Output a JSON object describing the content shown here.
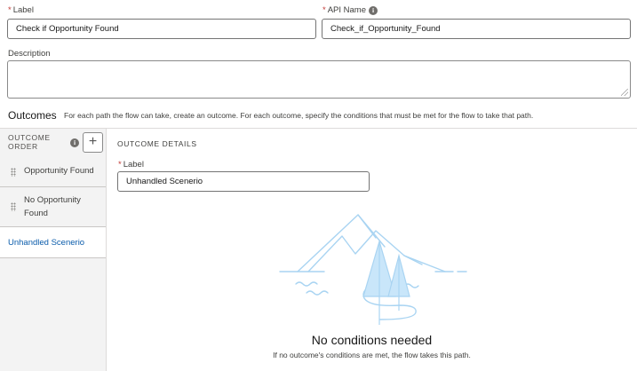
{
  "form": {
    "label": {
      "label": "Label",
      "value": "Check if Opportunity Found"
    },
    "api_name": {
      "label": "API Name",
      "value": "Check_if_Opportunity_Found"
    },
    "description": {
      "label": "Description",
      "value": ""
    }
  },
  "outcomes": {
    "title": "Outcomes",
    "help": "For each path the flow can take, create an outcome. For each outcome, specify the conditions that must be met for the flow to take that path.",
    "order_header_line1": "OUTCOME",
    "order_header_line2": "ORDER",
    "add_button": "+",
    "items": [
      {
        "line1": "Opportunity Found",
        "line2": ""
      },
      {
        "line1": "No Opportunity",
        "line2": "Found"
      },
      {
        "line1": "Unhandled Scenerio",
        "line2": ""
      }
    ]
  },
  "details": {
    "header": "OUTCOME DETAILS",
    "label": {
      "label": "Label",
      "value": "Unhandled Scenerio"
    },
    "empty_title": "No conditions needed",
    "empty_subtitle": "If no outcome's conditions are met, the flow takes this path."
  },
  "icons": {
    "info": "info-icon",
    "drag": "drag-handle-icon",
    "add": "add-icon"
  },
  "colors": {
    "required": "#c23934",
    "active_link": "#0b5cab",
    "illustration": "#a9d4f2"
  }
}
